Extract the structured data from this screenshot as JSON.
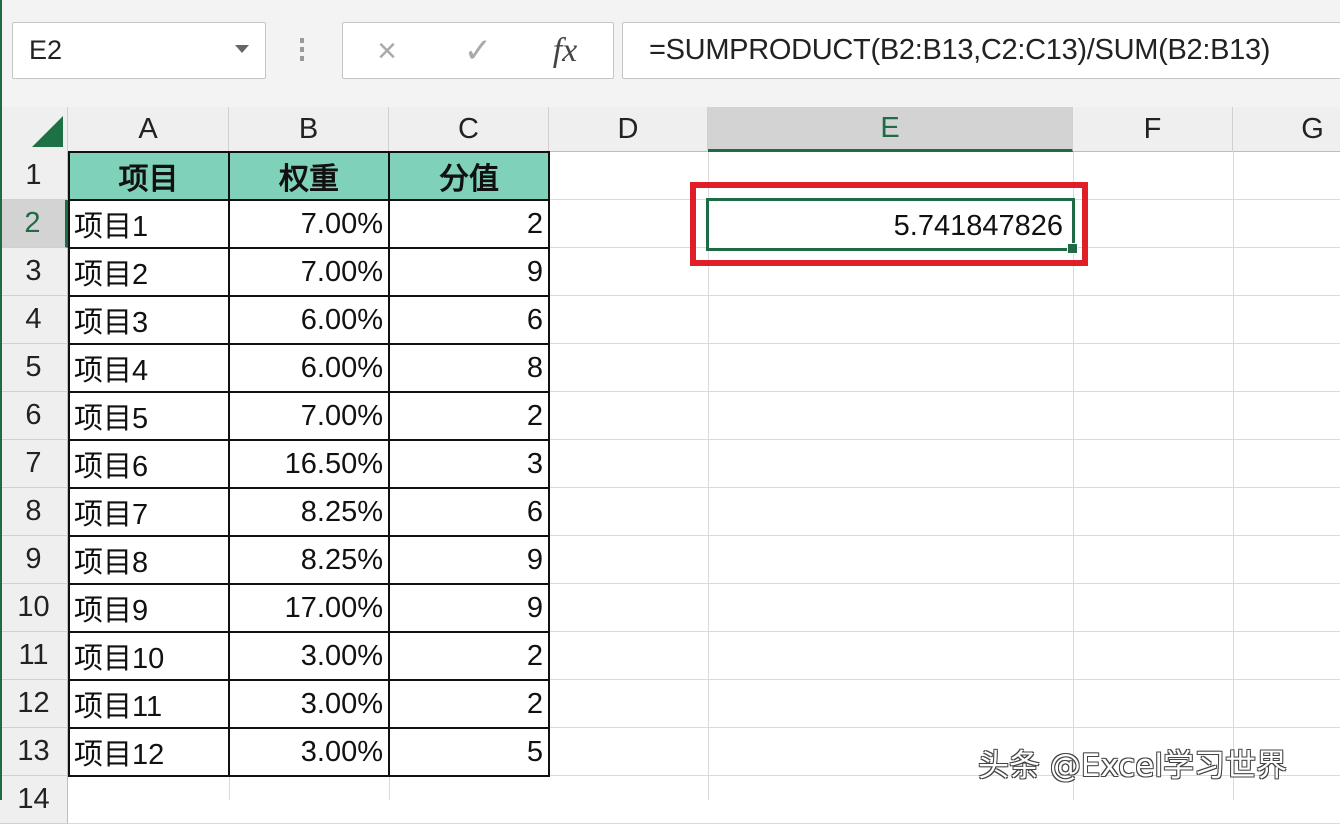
{
  "formula_bar": {
    "name_box": "E2",
    "cancel_icon": "×",
    "enter_icon": "✓",
    "fx_label": "fx",
    "formula": "=SUMPRODUCT(B2:B13,C2:C13)/SUM(B2:B13)"
  },
  "columns": [
    "A",
    "B",
    "C",
    "D",
    "E",
    "F",
    "G"
  ],
  "selected_column": "E",
  "rows": [
    "1",
    "2",
    "3",
    "4",
    "5",
    "6",
    "7",
    "8",
    "9",
    "10",
    "11",
    "12",
    "13",
    "14"
  ],
  "selected_row": "2",
  "table": {
    "headers": [
      "项目",
      "权重",
      "分值"
    ],
    "header_color": "#7fd1b9",
    "rows": [
      {
        "item": "项目1",
        "weight": "7.00%",
        "score": "2"
      },
      {
        "item": "项目2",
        "weight": "7.00%",
        "score": "9"
      },
      {
        "item": "项目3",
        "weight": "6.00%",
        "score": "6"
      },
      {
        "item": "项目4",
        "weight": "6.00%",
        "score": "8"
      },
      {
        "item": "项目5",
        "weight": "7.00%",
        "score": "2"
      },
      {
        "item": "项目6",
        "weight": "16.50%",
        "score": "3"
      },
      {
        "item": "项目7",
        "weight": "8.25%",
        "score": "6"
      },
      {
        "item": "项目8",
        "weight": "8.25%",
        "score": "9"
      },
      {
        "item": "项目9",
        "weight": "17.00%",
        "score": "9"
      },
      {
        "item": "项目10",
        "weight": "3.00%",
        "score": "2"
      },
      {
        "item": "项目11",
        "weight": "3.00%",
        "score": "2"
      },
      {
        "item": "项目12",
        "weight": "3.00%",
        "score": "5"
      }
    ]
  },
  "active_cell": {
    "ref": "E2",
    "value": "5.741847826",
    "highlight_color": "#e01e28"
  },
  "watermark": "头条 @Excel学习世界",
  "colors": {
    "excel_green": "#1e6b46",
    "header_bg": "#efefef"
  }
}
